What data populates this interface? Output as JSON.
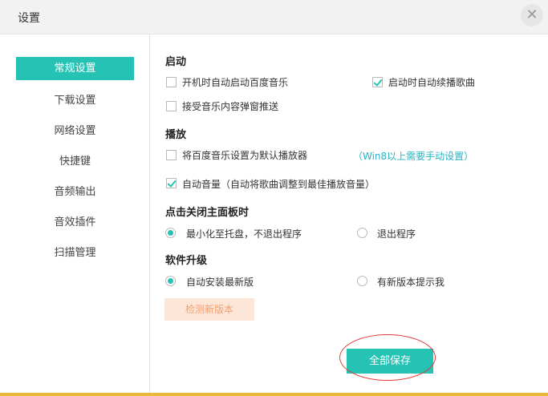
{
  "window": {
    "title": "设置",
    "close_glyph": "✕"
  },
  "sidebar": {
    "items": [
      {
        "label": "常规设置",
        "active": true
      },
      {
        "label": "下载设置"
      },
      {
        "label": "网络设置"
      },
      {
        "label": "快捷键"
      },
      {
        "label": "音频输出"
      },
      {
        "label": "音效插件"
      },
      {
        "label": "扫描管理"
      }
    ]
  },
  "startup": {
    "heading": "启动",
    "autostart_label": "开机时自动启动百度音乐",
    "autostart_checked": false,
    "resume_label": "启动时自动续播歌曲",
    "resume_checked": true,
    "push_label": "接受音乐内容弹窗推送",
    "push_checked": false
  },
  "playback": {
    "heading": "播放",
    "default_player_label": "将百度音乐设置为默认播放器",
    "default_player_checked": false,
    "win8_hint": "（Win8以上需要手动设置）",
    "auto_volume_label": "自动音量（自动将歌曲调整到最佳播放音量）",
    "auto_volume_checked": true
  },
  "close_panel": {
    "heading": "点击关闭主面板时",
    "minimize_label": "最小化至托盘，不退出程序",
    "exit_label": "退出程序",
    "selected": "minimize"
  },
  "upgrade": {
    "heading": "软件升级",
    "auto_install_label": "自动安装最新版",
    "notify_label": "有新版本提示我",
    "selected": "auto_install",
    "check_button": "检测新版本"
  },
  "footer": {
    "save_button": "全部保存"
  },
  "colors": {
    "accent": "#26c3b4",
    "hint": "#2ab2c2",
    "check_bg": "#fde6d8",
    "check_text": "#f0a070",
    "annotation": "#e23a3a"
  }
}
